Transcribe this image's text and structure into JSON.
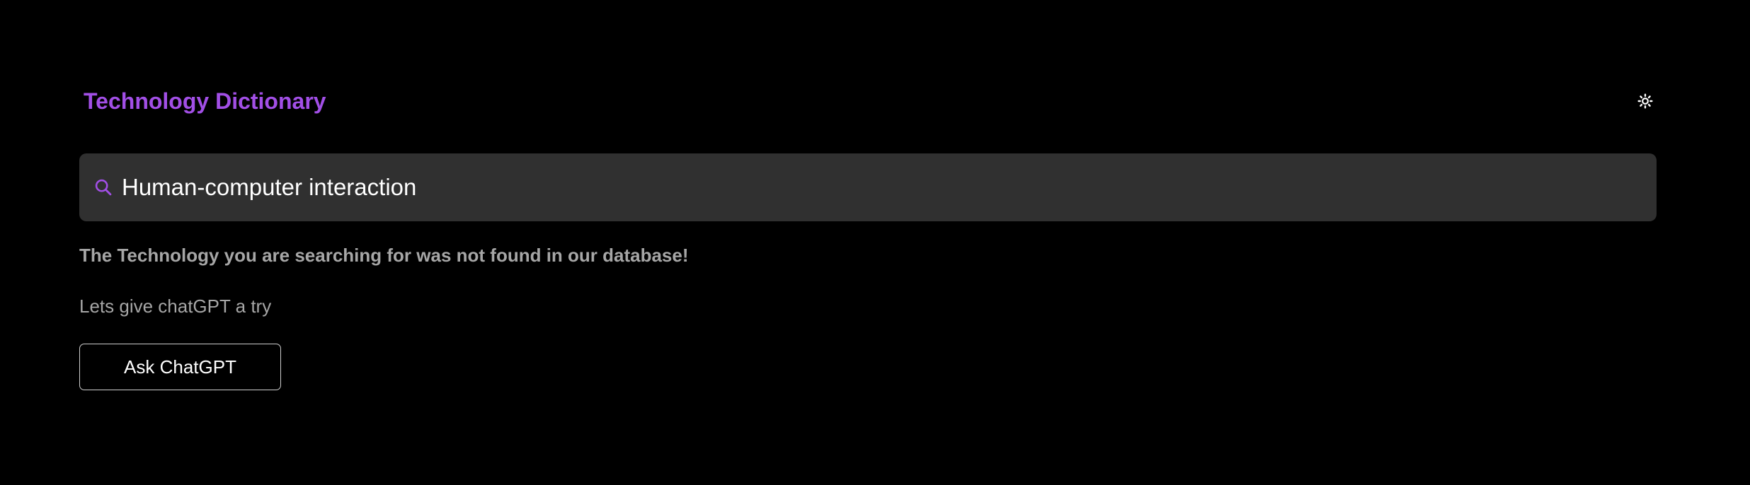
{
  "header": {
    "title": "Technology Dictionary",
    "theme_toggle_icon": "sun-icon"
  },
  "search": {
    "icon": "search-icon",
    "value": "Human-computer interaction",
    "placeholder": ""
  },
  "result": {
    "not_found_message": "The Technology you are searching for was not found in our database!",
    "suggestion_text": "Lets give chatGPT a try",
    "ask_button_label": "Ask ChatGPT"
  },
  "colors": {
    "background": "#000000",
    "accent": "#a24fe6",
    "search_background": "#303030",
    "muted_text": "#a6a6a6",
    "text": "#ffffff"
  }
}
